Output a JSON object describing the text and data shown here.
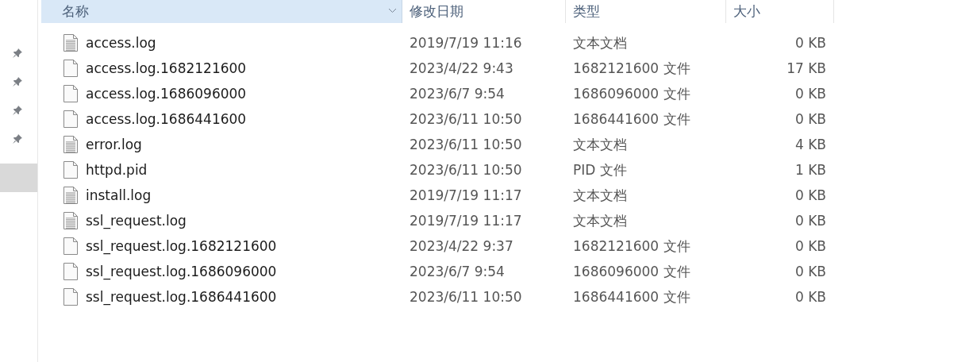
{
  "columns": [
    {
      "label": "名称",
      "sorted": true
    },
    {
      "label": "修改日期",
      "sorted": false
    },
    {
      "label": "类型",
      "sorted": false
    },
    {
      "label": "大小",
      "sorted": false
    }
  ],
  "files": [
    {
      "kind": "text",
      "name": "access.log",
      "modified": "2019/7/19 11:16",
      "type": "文本文档",
      "size": "0 KB"
    },
    {
      "kind": "blank",
      "name": "access.log.1682121600",
      "modified": "2023/4/22 9:43",
      "type": "1682121600 文件",
      "size": "17 KB"
    },
    {
      "kind": "blank",
      "name": "access.log.1686096000",
      "modified": "2023/6/7 9:54",
      "type": "1686096000 文件",
      "size": "0 KB"
    },
    {
      "kind": "blank",
      "name": "access.log.1686441600",
      "modified": "2023/6/11 10:50",
      "type": "1686441600 文件",
      "size": "0 KB"
    },
    {
      "kind": "text",
      "name": "error.log",
      "modified": "2023/6/11 10:50",
      "type": "文本文档",
      "size": "4 KB"
    },
    {
      "kind": "blank",
      "name": "httpd.pid",
      "modified": "2023/6/11 10:50",
      "type": "PID 文件",
      "size": "1 KB"
    },
    {
      "kind": "text",
      "name": "install.log",
      "modified": "2019/7/19 11:17",
      "type": "文本文档",
      "size": "0 KB"
    },
    {
      "kind": "text",
      "name": "ssl_request.log",
      "modified": "2019/7/19 11:17",
      "type": "文本文档",
      "size": "0 KB"
    },
    {
      "kind": "blank",
      "name": "ssl_request.log.1682121600",
      "modified": "2023/4/22 9:37",
      "type": "1682121600 文件",
      "size": "0 KB"
    },
    {
      "kind": "blank",
      "name": "ssl_request.log.1686096000",
      "modified": "2023/6/7 9:54",
      "type": "1686096000 文件",
      "size": "0 KB"
    },
    {
      "kind": "blank",
      "name": "ssl_request.log.1686441600",
      "modified": "2023/6/11 10:50",
      "type": "1686441600 文件",
      "size": "0 KB"
    }
  ]
}
